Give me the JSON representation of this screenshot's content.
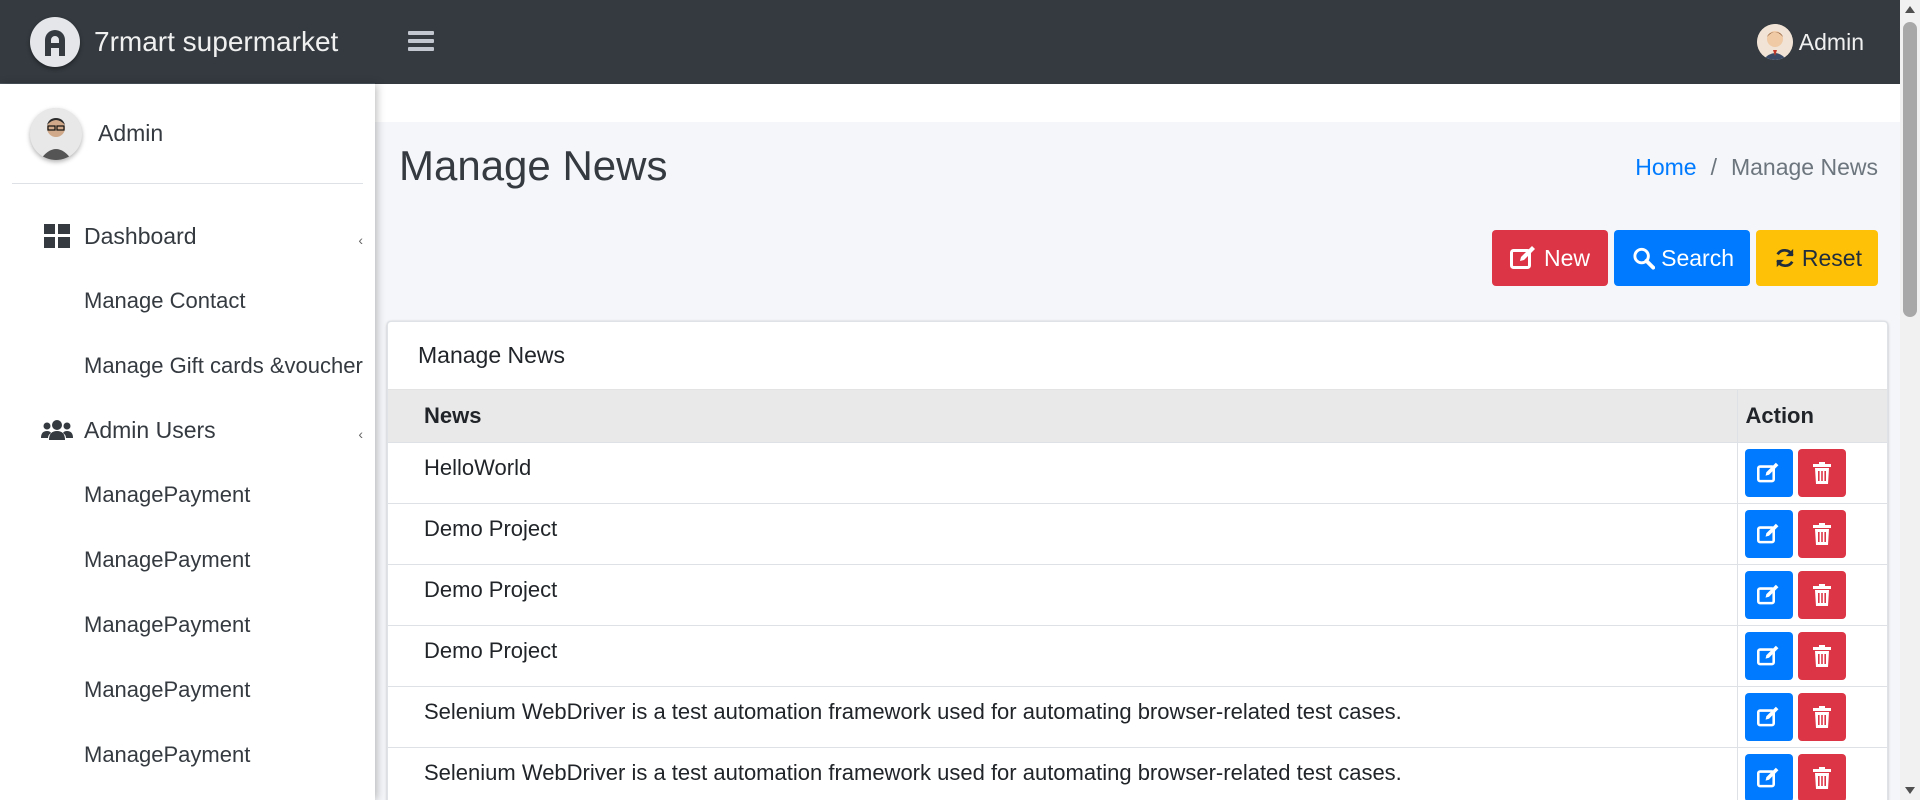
{
  "app": {
    "brand": "7rmart supermarket",
    "user": "Admin"
  },
  "sidebar": {
    "user": "Admin",
    "items": [
      {
        "type": "group",
        "label": "Dashboard",
        "icon": "dashboard-icon"
      },
      {
        "type": "sub",
        "label": "Manage Contact"
      },
      {
        "type": "sub",
        "label": "Manage Gift cards &voucher"
      },
      {
        "type": "group",
        "label": "Admin Users",
        "icon": "users-icon"
      },
      {
        "type": "sub",
        "label": "ManagePayment"
      },
      {
        "type": "sub",
        "label": "ManagePayment"
      },
      {
        "type": "sub",
        "label": "ManagePayment"
      },
      {
        "type": "sub",
        "label": "ManagePayment"
      },
      {
        "type": "sub",
        "label": "ManagePayment"
      }
    ]
  },
  "page": {
    "title": "Manage News",
    "breadcrumb": {
      "home": "Home",
      "separator": "/",
      "current": "Manage News"
    }
  },
  "toolbar": {
    "new_label": "New",
    "search_label": "Search",
    "reset_label": "Reset"
  },
  "card": {
    "title": "Manage News",
    "columns": [
      "News",
      "Action"
    ],
    "rows": [
      "HelloWorld",
      "Demo Project",
      "Demo Project",
      "Demo Project",
      "Selenium WebDriver is a test automation framework used for automating browser-related test cases.",
      "Selenium WebDriver is a test automation framework used for automating browser-related test cases."
    ]
  },
  "colors": {
    "navbar": "#343a40",
    "primary": "#007bff",
    "danger": "#dc3545",
    "warning": "#ffc107"
  }
}
